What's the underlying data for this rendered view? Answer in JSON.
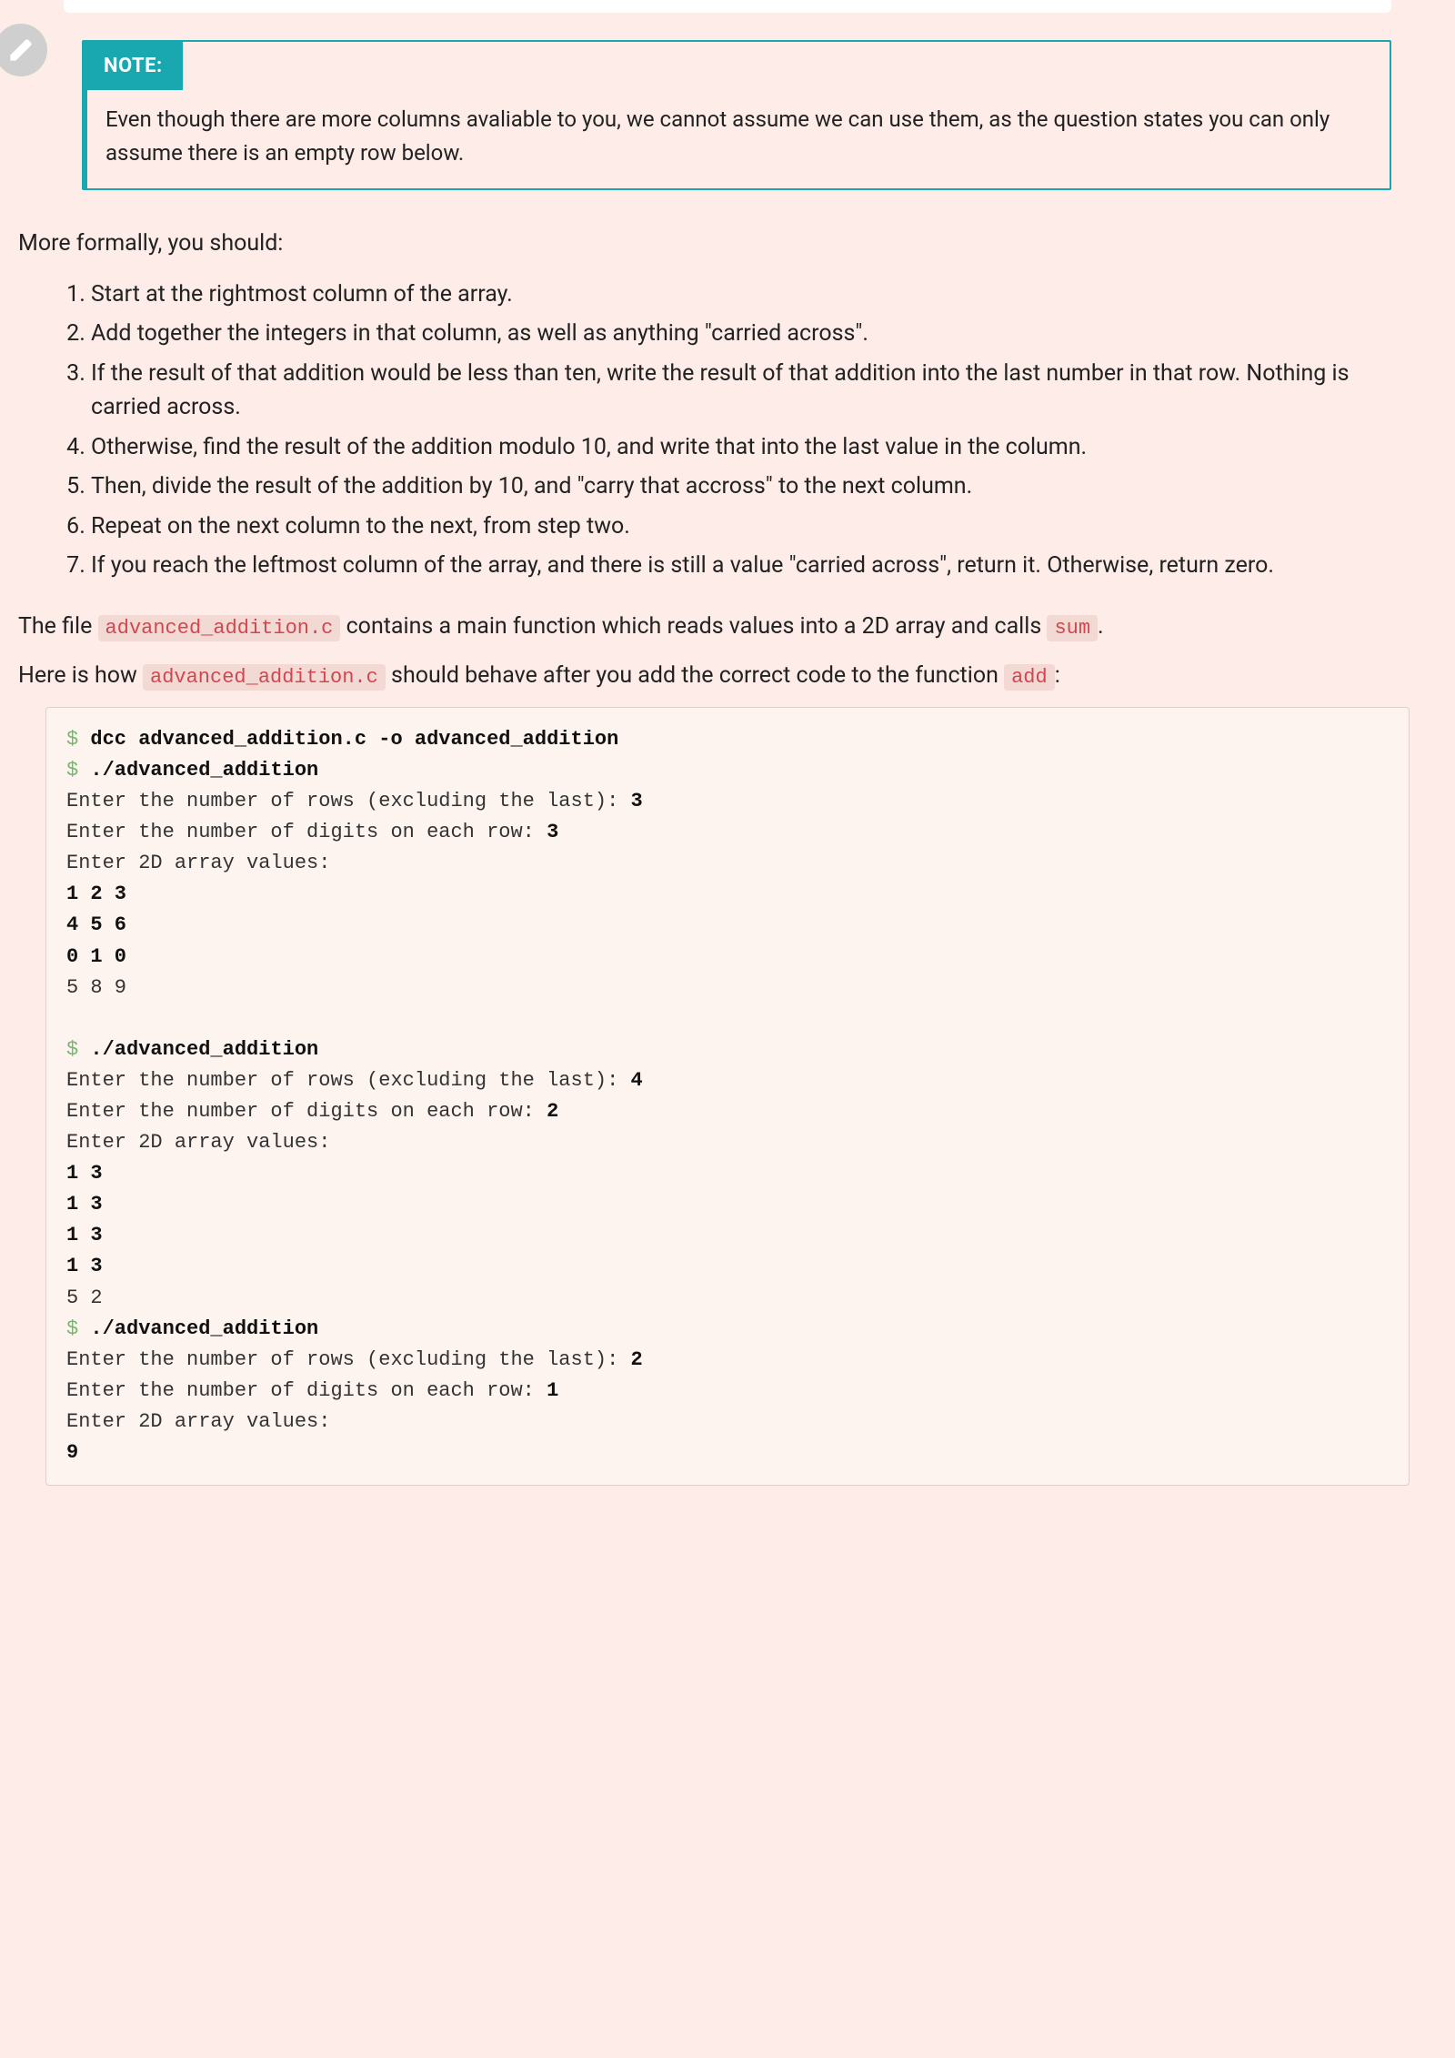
{
  "edit_icon": "pencil-icon",
  "note": {
    "title": "NOTE:",
    "body": "Even though there are more columns avaliable to you, we cannot assume we can use them, as the question states you can only assume there is an empty row below."
  },
  "intro": "More formally, you should:",
  "steps": [
    "Start at the rightmost column of the array.",
    "Add together the integers in that column, as well as anything \"carried across\".",
    "If the result of that addition would be less than ten, write the result of that addition into the last number in that row. Nothing is carried across.",
    "Otherwise, find the result of the addition modulo 10, and write that into the last value in the column.",
    "Then, divide the result of the addition by 10, and \"carry that accross\" to the next column.",
    "Repeat on the next column to the next, from step two.",
    "If you reach the leftmost column of the array, and there is still a value \"carried across\", return it. Otherwise, return zero."
  ],
  "file_sentence": {
    "prefix": "The file ",
    "code1": "advanced_addition.c",
    "mid": " contains a main function which reads values into a 2D array and calls ",
    "code2": "sum",
    "suffix": "."
  },
  "behave_sentence": {
    "prefix": "Here is how ",
    "code1": "advanced_addition.c",
    "mid": " should behave after you add the correct code to the function ",
    "code2": "add",
    "suffix": ":"
  },
  "terminal": {
    "prompt": "$",
    "cmd1": "dcc advanced_addition.c -o advanced_addition",
    "cmd2": "./advanced_addition",
    "l_rows": "Enter the number of rows (excluding the last): ",
    "l_cols": "Enter the number of digits on each row: ",
    "l_enter": "Enter 2D array values:",
    "run1": {
      "rows": "3",
      "cols": "3",
      "inputs": [
        "1 2 3",
        "4 5 6",
        "0 1 0"
      ],
      "output": "5 8 9"
    },
    "run2": {
      "rows": "4",
      "cols": "2",
      "inputs": [
        "1 3",
        "1 3",
        "1 3",
        "1 3"
      ],
      "output": "5 2"
    },
    "run3": {
      "rows": "2",
      "cols": "1",
      "inputs": [
        "9"
      ]
    }
  }
}
